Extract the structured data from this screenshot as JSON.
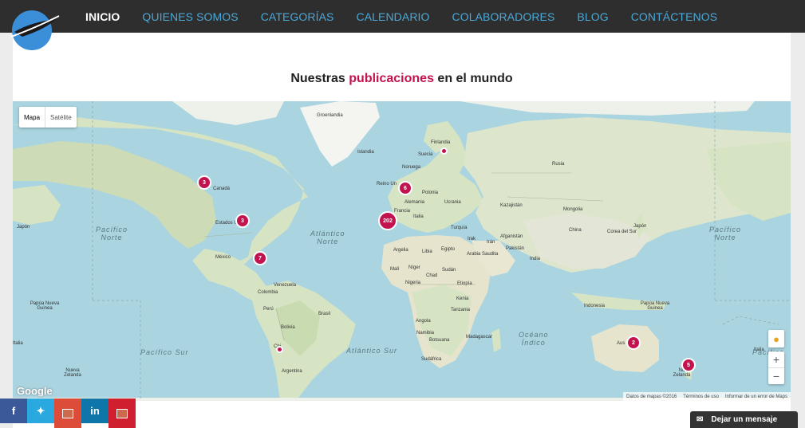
{
  "nav": {
    "items": [
      "INICIO",
      "QUIENES SOMOS",
      "CATEGORÍAS",
      "CALENDARIO",
      "COLABORADORES",
      "BLOG",
      "CONTÁCTENOS"
    ],
    "active_index": 0
  },
  "page": {
    "heading_pre": "Nuestras ",
    "heading_highlight": "publicaciones",
    "heading_post": " en el mundo",
    "accent_color": "#c2134f"
  },
  "map": {
    "type_options": [
      "Mapa",
      "Satélite"
    ],
    "selected_type": "Mapa",
    "zoom_in": "+",
    "zoom_out": "−",
    "google": "Google",
    "attribution": [
      "Datos de mapas ©2016",
      "Términos de uso",
      "Informar de un error de Maps"
    ],
    "markers": [
      {
        "id": "canada",
        "count": "3"
      },
      {
        "id": "usa",
        "count": "3"
      },
      {
        "id": "mexico",
        "count": "7"
      },
      {
        "id": "europe-north",
        "count": "6"
      },
      {
        "id": "spain",
        "count": "202"
      },
      {
        "id": "australia",
        "count": "2"
      },
      {
        "id": "new-zealand",
        "count": "5"
      }
    ],
    "labels": {
      "groenlandia": "Groenlandia",
      "islandia": "Islandia",
      "finlandia": "Finlandia",
      "suecia": "Suecia",
      "noruega": "Noruega",
      "reino_unido": "Reino Un",
      "polonia": "Polonia",
      "alemania": "Alemania",
      "ucrania": "Ucrania",
      "francia": "Francia",
      "italia": "Italia",
      "turquia": "Turquía",
      "rusia": "Rusia",
      "kazajistan": "Kazajistán",
      "mongolia": "Mongolia",
      "china": "China",
      "corea": "Corea del Sur",
      "japon_r": "Japón",
      "japon_l": "Japón",
      "irak": "Irak",
      "iran": "Irán",
      "afganistan": "Afganistán",
      "pakistan": "Pakistán",
      "india": "India",
      "arabia": "Arabia Saudita",
      "egipto": "Egipto",
      "libia": "Libia",
      "argelia": "Argelia",
      "mali": "Malí",
      "niger": "Níger",
      "chad": "Chad",
      "sudan": "Sudán",
      "nigeria": "Nigeria",
      "etiopia": "Etiopía",
      "kenia": "Kenia",
      "tanzania": "Tanzania",
      "angola": "Angola",
      "namibia": "Namibia",
      "botsuana": "Botsuana",
      "madagascar": "Madagascar",
      "sudafrica": "Sudáfrica",
      "canada": "Canadá",
      "estados_unidos": "Estados Unidos",
      "mexico": "México",
      "venezuela": "Venezuela",
      "colombia": "Colombia",
      "peru": "Perú",
      "brasil": "Brasil",
      "bolivia": "Bolivia",
      "argentina": "Argentina",
      "chile": "Chi",
      "indonesia": "Indonesia",
      "australia": "Aus",
      "png_l": "Papúa Nueva Guinea",
      "png_r": "Papúa Nueva Guinea",
      "nz_l": "Nueva Zelanda",
      "nz_r": "Nu Zelanda",
      "italia_l": "Italia",
      "italia_r": "Italia"
    },
    "oceans": {
      "pac_norte_l": "Pacífico\nNorte",
      "atl_norte": "Atlántico\nNorte",
      "pac_norte_r": "Pacífico\nNorte",
      "pac_sur": "Pacífico Sur",
      "atl_sur": "Atlántico Sur",
      "indico": "Océano\nÍndico",
      "pac_sur_r": "Pacífico"
    }
  },
  "social": {
    "facebook": "f",
    "twitter": "t",
    "linkedin": "in"
  },
  "chat": {
    "label": "Dejar un mensaje"
  }
}
